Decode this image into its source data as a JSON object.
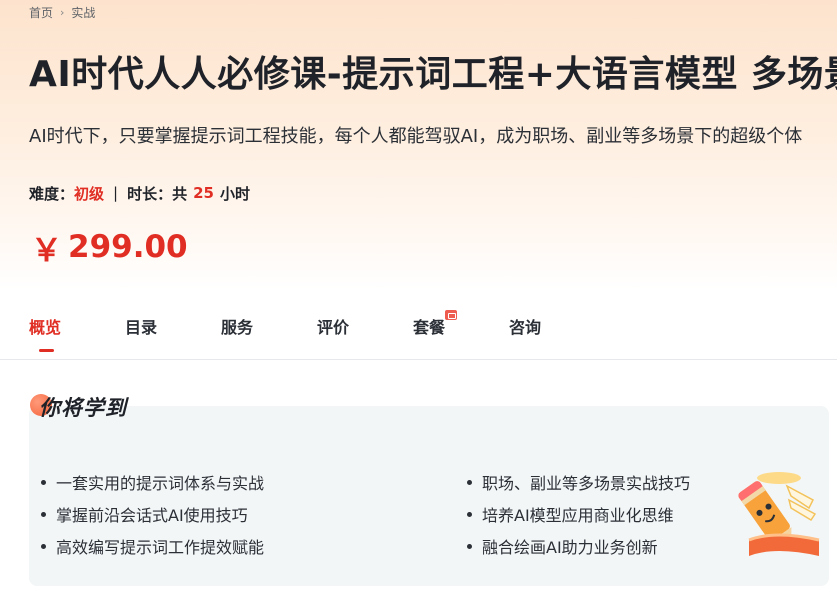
{
  "breadcrumb": {
    "home": "首页",
    "current": "实战"
  },
  "course": {
    "title": "AI时代人人必修课-提示词工程+大语言模型 多场景实战",
    "subtitle": "AI时代下，只要掌握提示词工程技能，每个人都能驾驭AI，成为职场、副业等多场景下的超级个体",
    "difficulty_label": "难度：",
    "difficulty_value": "初级",
    "separator": "|",
    "duration_label": "时长：共",
    "duration_value": "25",
    "duration_unit": "小时",
    "currency": "￥",
    "price": "299.00"
  },
  "tabs": [
    {
      "label": "概览",
      "active": true
    },
    {
      "label": "目录"
    },
    {
      "label": "服务"
    },
    {
      "label": "评价"
    },
    {
      "label": "套餐",
      "badge": true
    },
    {
      "label": "咨询"
    }
  ],
  "learn": {
    "heading": "你将学到",
    "left_items": [
      "一套实用的提示词体系与实战",
      "掌握前沿会话式AI使用技巧",
      "高效编写提示词工作提效赋能"
    ],
    "right_items": [
      "职场、副业等多场景实战技巧",
      "培养AI模型应用商业化思维",
      "融合绘画AI助力业务创新"
    ]
  },
  "icons": {
    "breadcrumb_sep": "chevron-right-icon",
    "tab_badge": "gift-badge-icon",
    "mascot": "pencil-mascot-icon"
  },
  "colors": {
    "accent": "#e02e24",
    "hero_top": "#fde3cd",
    "learn_bg": "#f3f6f7"
  }
}
